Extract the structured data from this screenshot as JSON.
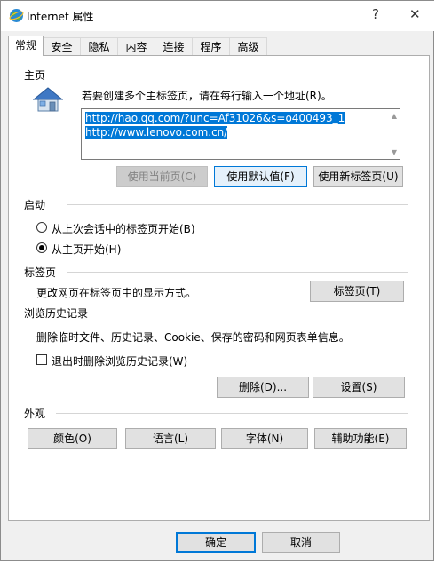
{
  "window": {
    "title": "Internet 属性",
    "help_glyph": "?",
    "close_glyph": "✕"
  },
  "tabs": [
    "常规",
    "安全",
    "隐私",
    "内容",
    "连接",
    "程序",
    "高级"
  ],
  "home": {
    "label": "主页",
    "instruction": "若要创建多个主标签页，请在每行输入一个地址(R)。",
    "urls": [
      "http://hao.qq.com/?unc=Af31026&s=o400493_1",
      "http://www.lenovo.com.cn/"
    ],
    "use_current": "使用当前页(C)",
    "use_default": "使用默认值(F)",
    "use_new_tab": "使用新标签页(U)"
  },
  "startup": {
    "label": "启动",
    "option_last_session": "从上次会话中的标签页开始(B)",
    "option_home": "从主页开始(H)",
    "selected": "option_home"
  },
  "tabs_section": {
    "label": "标签页",
    "description": "更改网页在标签页中的显示方式。",
    "button": "标签页(T)"
  },
  "history": {
    "label": "浏览历史记录",
    "description": "删除临时文件、历史记录、Cookie、保存的密码和网页表单信息。",
    "checkbox": "退出时删除浏览历史记录(W)",
    "checked": false,
    "delete": "删除(D)...",
    "settings": "设置(S)"
  },
  "appearance": {
    "label": "外观",
    "colors": "颜色(O)",
    "languages": "语言(L)",
    "fonts": "字体(N)",
    "accessibility": "辅助功能(E)"
  },
  "footer": {
    "ok": "确定",
    "cancel": "取消"
  },
  "colors": {
    "accent": "#0078d7",
    "disabled_text": "#838383"
  }
}
